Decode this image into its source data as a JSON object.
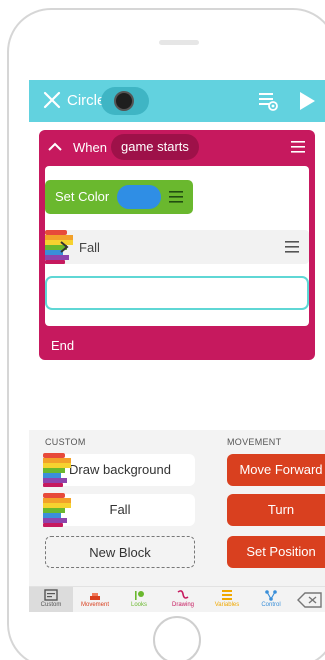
{
  "toolbar": {
    "title": "Circle",
    "icons": [
      "close-icon",
      "sprite-icon",
      "debug-list-icon",
      "play-icon"
    ]
  },
  "event_block": {
    "when_label": "When",
    "trigger": "game starts",
    "end_label": "End",
    "color": "#c6195e"
  },
  "blocks": {
    "set_color": {
      "label": "Set Color",
      "color_value": "#2f8ee5"
    },
    "fall": {
      "label": "Fall"
    }
  },
  "palette": {
    "custom_label": "CUSTOM",
    "movement_label": "MOVEMENT",
    "custom_blocks": [
      "Draw background",
      "Fall",
      "New Block"
    ],
    "movement_blocks": [
      "Move Forward",
      "Turn",
      "Set Position"
    ]
  },
  "tabs": [
    {
      "label": "Custom",
      "color": "#555555",
      "active": true
    },
    {
      "label": "Movement",
      "color": "#d9401f",
      "active": false
    },
    {
      "label": "Looks",
      "color": "#6ab82e",
      "active": false
    },
    {
      "label": "Drawing",
      "color": "#c6195e",
      "active": false
    },
    {
      "label": "Variables",
      "color": "#f0a800",
      "active": false
    },
    {
      "label": "Control",
      "color": "#3a8fd9",
      "active": false
    }
  ],
  "colors": {
    "toolbar": "#62d2df",
    "movement": "#d9401f",
    "looks": "#6ab82e",
    "drop_slot": "#5fd7d5"
  }
}
